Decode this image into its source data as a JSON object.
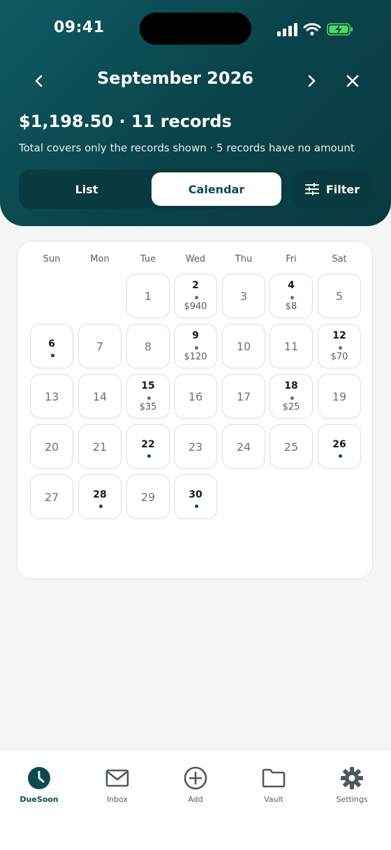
{
  "status_bar": {
    "time": "09:41"
  },
  "header": {
    "month_title": "September 2026",
    "summary": "$1,198.50 · 11 records",
    "note": "Total covers only the records shown · 5 records have no amount",
    "view_toggle": {
      "list": "List",
      "calendar": "Calendar",
      "selected": "Calendar"
    },
    "filter_label": "Filter"
  },
  "calendar": {
    "weekdays": [
      "Sun",
      "Mon",
      "Tue",
      "Wed",
      "Thu",
      "Fri",
      "Sat"
    ],
    "first_weekday": 2,
    "days_in_month": 30,
    "days": {
      "1": "1",
      "2": "2",
      "3": "3",
      "4": "4",
      "5": "5",
      "6": "6",
      "7": "7",
      "8": "8",
      "9": "9",
      "10": "10",
      "11": "11",
      "12": "12",
      "13": "13",
      "14": "14",
      "15": "15",
      "16": "16",
      "17": "17",
      "18": "18",
      "19": "19",
      "20": "20",
      "21": "21",
      "22": "22",
      "23": "23",
      "24": "24",
      "25": "25",
      "26": "26",
      "27": "27",
      "28": "28",
      "29": "29",
      "30": "30"
    },
    "events": {
      "2": {
        "amount": "$940"
      },
      "4": {
        "amount": "$8"
      },
      "6": {
        "amount": ""
      },
      "9": {
        "amount": "$120"
      },
      "12": {
        "amount": "$70"
      },
      "15": {
        "amount": "$35"
      },
      "18": {
        "amount": "$25"
      },
      "22": {
        "amount": ""
      },
      "26": {
        "amount": ""
      },
      "28": {
        "amount": ""
      },
      "30": {
        "amount": ""
      }
    }
  },
  "tabs": [
    {
      "id": "duesoon",
      "label": "DueSoon",
      "icon": "clock-icon",
      "active": true
    },
    {
      "id": "inbox",
      "label": "Inbox",
      "icon": "mail-icon",
      "active": false
    },
    {
      "id": "add",
      "label": "Add",
      "icon": "plus-circle-icon",
      "active": false
    },
    {
      "id": "vault",
      "label": "Vault",
      "icon": "folder-icon",
      "active": false
    },
    {
      "id": "settings",
      "label": "Settings",
      "icon": "gear-icon",
      "active": false
    }
  ],
  "colors": {
    "header_bg": "#0a4249",
    "accent": "#0d4a52",
    "battery": "#4cd964",
    "page_bg": "#f2f6f5"
  }
}
